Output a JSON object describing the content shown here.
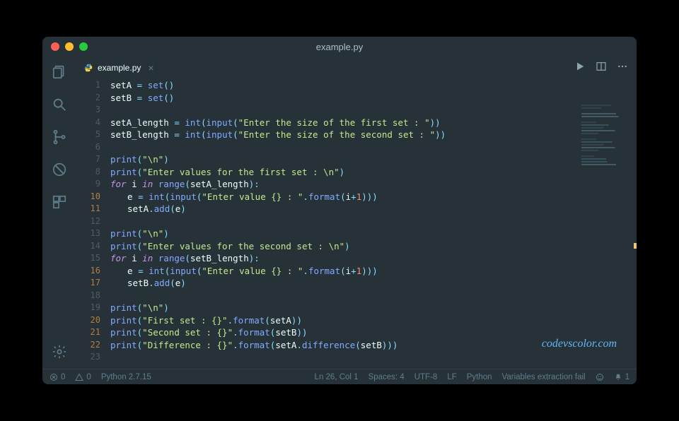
{
  "window": {
    "title": "example.py"
  },
  "tab": {
    "label": "example.py"
  },
  "watermark": "codevscolor.com",
  "status": {
    "errors": "0",
    "warnings": "0",
    "lang_version": "Python 2.7.15",
    "cursor": "Ln 26, Col 1",
    "spaces": "Spaces: 4",
    "encoding": "UTF-8",
    "eol": "LF",
    "language": "Python",
    "message": "Variables extraction fail",
    "notifications": "1"
  },
  "code": {
    "lines": [
      {
        "n": 1,
        "indent": 0,
        "tokens": [
          [
            "var",
            "setA"
          ],
          [
            "plain",
            " "
          ],
          [
            "op",
            "="
          ],
          [
            "plain",
            " "
          ],
          [
            "fn",
            "set"
          ],
          [
            "punct",
            "()"
          ]
        ]
      },
      {
        "n": 2,
        "indent": 0,
        "tokens": [
          [
            "var",
            "setB"
          ],
          [
            "plain",
            " "
          ],
          [
            "op",
            "="
          ],
          [
            "plain",
            " "
          ],
          [
            "fn",
            "set"
          ],
          [
            "punct",
            "()"
          ]
        ]
      },
      {
        "n": 3,
        "indent": 0,
        "tokens": []
      },
      {
        "n": 4,
        "indent": 0,
        "tokens": [
          [
            "var",
            "setA_length"
          ],
          [
            "plain",
            " "
          ],
          [
            "op",
            "="
          ],
          [
            "plain",
            " "
          ],
          [
            "fn",
            "int"
          ],
          [
            "punct",
            "("
          ],
          [
            "fn",
            "input"
          ],
          [
            "punct",
            "("
          ],
          [
            "str",
            "\"Enter the size of the first set : \""
          ],
          [
            "punct",
            "))"
          ]
        ]
      },
      {
        "n": 5,
        "indent": 0,
        "tokens": [
          [
            "var",
            "setB_length"
          ],
          [
            "plain",
            " "
          ],
          [
            "op",
            "="
          ],
          [
            "plain",
            " "
          ],
          [
            "fn",
            "int"
          ],
          [
            "punct",
            "("
          ],
          [
            "fn",
            "input"
          ],
          [
            "punct",
            "("
          ],
          [
            "str",
            "\"Enter the size of the second set : \""
          ],
          [
            "punct",
            "))"
          ]
        ]
      },
      {
        "n": 6,
        "indent": 0,
        "tokens": []
      },
      {
        "n": 7,
        "indent": 0,
        "tokens": [
          [
            "fn",
            "print"
          ],
          [
            "punct",
            "("
          ],
          [
            "str",
            "\"\\n\""
          ],
          [
            "punct",
            ")"
          ]
        ]
      },
      {
        "n": 8,
        "indent": 0,
        "tokens": [
          [
            "fn",
            "print"
          ],
          [
            "punct",
            "("
          ],
          [
            "str",
            "\"Enter values for the first set : \\n\""
          ],
          [
            "punct",
            ")"
          ]
        ]
      },
      {
        "n": 9,
        "indent": 0,
        "tokens": [
          [
            "kw",
            "for"
          ],
          [
            "plain",
            " "
          ],
          [
            "var",
            "i"
          ],
          [
            "plain",
            " "
          ],
          [
            "kw",
            "in"
          ],
          [
            "plain",
            " "
          ],
          [
            "fn",
            "range"
          ],
          [
            "punct",
            "("
          ],
          [
            "var",
            "setA_length"
          ],
          [
            "punct",
            "):"
          ]
        ]
      },
      {
        "n": 10,
        "indent": 1,
        "tokens": [
          [
            "var",
            "e"
          ],
          [
            "plain",
            " "
          ],
          [
            "op",
            "="
          ],
          [
            "plain",
            " "
          ],
          [
            "fn",
            "int"
          ],
          [
            "punct",
            "("
          ],
          [
            "fn",
            "input"
          ],
          [
            "punct",
            "("
          ],
          [
            "str",
            "\"Enter value {} : \""
          ],
          [
            "punct",
            "."
          ],
          [
            "mth",
            "format"
          ],
          [
            "punct",
            "("
          ],
          [
            "var",
            "i"
          ],
          [
            "op",
            "+"
          ],
          [
            "num",
            "1"
          ],
          [
            "punct",
            ")))"
          ]
        ]
      },
      {
        "n": 11,
        "indent": 1,
        "tokens": [
          [
            "var",
            "setA"
          ],
          [
            "punct",
            "."
          ],
          [
            "mth",
            "add"
          ],
          [
            "punct",
            "("
          ],
          [
            "var",
            "e"
          ],
          [
            "punct",
            ")"
          ]
        ]
      },
      {
        "n": 12,
        "indent": 0,
        "tokens": []
      },
      {
        "n": 13,
        "indent": 0,
        "tokens": [
          [
            "fn",
            "print"
          ],
          [
            "punct",
            "("
          ],
          [
            "str",
            "\"\\n\""
          ],
          [
            "punct",
            ")"
          ]
        ]
      },
      {
        "n": 14,
        "indent": 0,
        "tokens": [
          [
            "fn",
            "print"
          ],
          [
            "punct",
            "("
          ],
          [
            "str",
            "\"Enter values for the second set : \\n\""
          ],
          [
            "punct",
            ")"
          ]
        ]
      },
      {
        "n": 15,
        "indent": 0,
        "tokens": [
          [
            "kw",
            "for"
          ],
          [
            "plain",
            " "
          ],
          [
            "var",
            "i"
          ],
          [
            "plain",
            " "
          ],
          [
            "kw",
            "in"
          ],
          [
            "plain",
            " "
          ],
          [
            "fn",
            "range"
          ],
          [
            "punct",
            "("
          ],
          [
            "var",
            "setB_length"
          ],
          [
            "punct",
            "):"
          ]
        ]
      },
      {
        "n": 16,
        "indent": 1,
        "tokens": [
          [
            "var",
            "e"
          ],
          [
            "plain",
            " "
          ],
          [
            "op",
            "="
          ],
          [
            "plain",
            " "
          ],
          [
            "fn",
            "int"
          ],
          [
            "punct",
            "("
          ],
          [
            "fn",
            "input"
          ],
          [
            "punct",
            "("
          ],
          [
            "str",
            "\"Enter value {} : \""
          ],
          [
            "punct",
            "."
          ],
          [
            "mth",
            "format"
          ],
          [
            "punct",
            "("
          ],
          [
            "var",
            "i"
          ],
          [
            "op",
            "+"
          ],
          [
            "num",
            "1"
          ],
          [
            "punct",
            ")))"
          ]
        ]
      },
      {
        "n": 17,
        "indent": 1,
        "tokens": [
          [
            "var",
            "setB"
          ],
          [
            "punct",
            "."
          ],
          [
            "mth",
            "add"
          ],
          [
            "punct",
            "("
          ],
          [
            "var",
            "e"
          ],
          [
            "punct",
            ")"
          ]
        ]
      },
      {
        "n": 18,
        "indent": 0,
        "tokens": []
      },
      {
        "n": 19,
        "indent": 0,
        "tokens": [
          [
            "fn",
            "print"
          ],
          [
            "punct",
            "("
          ],
          [
            "str",
            "\"\\n\""
          ],
          [
            "punct",
            ")"
          ]
        ]
      },
      {
        "n": 20,
        "indent": 0,
        "tokens": [
          [
            "fn",
            "print"
          ],
          [
            "punct",
            "("
          ],
          [
            "str",
            "\"First set : {}\""
          ],
          [
            "punct",
            "."
          ],
          [
            "mth",
            "format"
          ],
          [
            "punct",
            "("
          ],
          [
            "var",
            "setA"
          ],
          [
            "punct",
            "))"
          ]
        ]
      },
      {
        "n": 21,
        "indent": 0,
        "tokens": [
          [
            "fn",
            "print"
          ],
          [
            "punct",
            "("
          ],
          [
            "str",
            "\"Second set : {}\""
          ],
          [
            "punct",
            "."
          ],
          [
            "mth",
            "format"
          ],
          [
            "punct",
            "("
          ],
          [
            "var",
            "setB"
          ],
          [
            "punct",
            "))"
          ]
        ]
      },
      {
        "n": 22,
        "indent": 0,
        "tokens": [
          [
            "fn",
            "print"
          ],
          [
            "punct",
            "("
          ],
          [
            "str",
            "\"Difference : {}\""
          ],
          [
            "punct",
            "."
          ],
          [
            "mth",
            "format"
          ],
          [
            "punct",
            "("
          ],
          [
            "var",
            "setA"
          ],
          [
            "punct",
            "."
          ],
          [
            "mth",
            "difference"
          ],
          [
            "punct",
            "("
          ],
          [
            "var",
            "setB"
          ],
          [
            "punct",
            ")))"
          ]
        ]
      },
      {
        "n": 23,
        "indent": 0,
        "tokens": []
      }
    ]
  }
}
